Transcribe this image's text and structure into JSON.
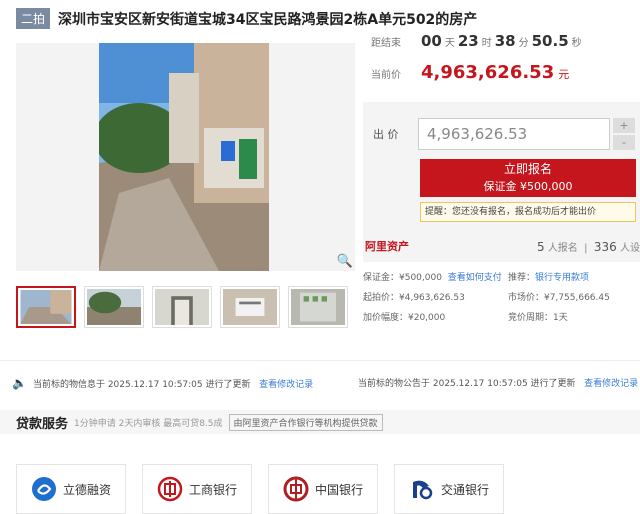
{
  "header": {
    "tag": "二拍",
    "title": "深圳市宝安区新安街道宝城34区宝民路鸿景园2栋A单元502的房产"
  },
  "countdown": {
    "label": "距结束",
    "days": "00",
    "days_unit": "天",
    "hours": "23",
    "hours_unit": "时",
    "minutes": "38",
    "minutes_unit": "分",
    "seconds": "50.5",
    "seconds_unit": "秒"
  },
  "current_price": {
    "label": "当前价",
    "value": "4,963,626.53",
    "unit": "元"
  },
  "bid": {
    "label": "出 价",
    "value": "4,963,626.53",
    "plus": "+",
    "minus": "-"
  },
  "signup": {
    "line1": "立即报名",
    "line2": "保证金 ¥500,000"
  },
  "tip": "提醒：您还没有报名，报名成功后才能出价",
  "ali": {
    "logo": "阿里资产",
    "signup_count": "5",
    "signup_label": "人报名",
    "watch_count": "336",
    "watch_label": "人设"
  },
  "details": {
    "deposit": "保证金：¥500,000",
    "deposit_link": "查看如何支付",
    "recommend": "推荐：",
    "recommend_link": "银行专用款项",
    "start": "起拍价：¥4,963,626.53",
    "market": "市场价：¥7,755,666.45",
    "increment": "加价幅度：¥20,000",
    "period": "竞价周期：1天"
  },
  "notices": [
    {
      "text": "当前标的物信息于 2025.12.17 10:57:05 进行了更新",
      "link": "查看修改记录"
    },
    {
      "text": "当前标的物公告于 2025.12.17 10:57:05 进行了更新",
      "link": "查看修改记录"
    }
  ],
  "loan": {
    "title": "贷款服务",
    "sub": "1分钟申请 2天内审核 最高可贷8.5成",
    "box": "由阿里资产合作银行等机构提供贷款"
  },
  "banks": [
    {
      "name": "立德融资",
      "icon": "lide-logo-icon",
      "color": "#1f6fd0"
    },
    {
      "name": "工商银行",
      "icon": "icbc-logo-icon",
      "color": "#c4161c"
    },
    {
      "name": "中国银行",
      "icon": "boc-logo-icon",
      "color": "#b01f24"
    },
    {
      "name": "交通银行",
      "icon": "bocom-logo-icon",
      "color": "#1b3f8f"
    }
  ]
}
